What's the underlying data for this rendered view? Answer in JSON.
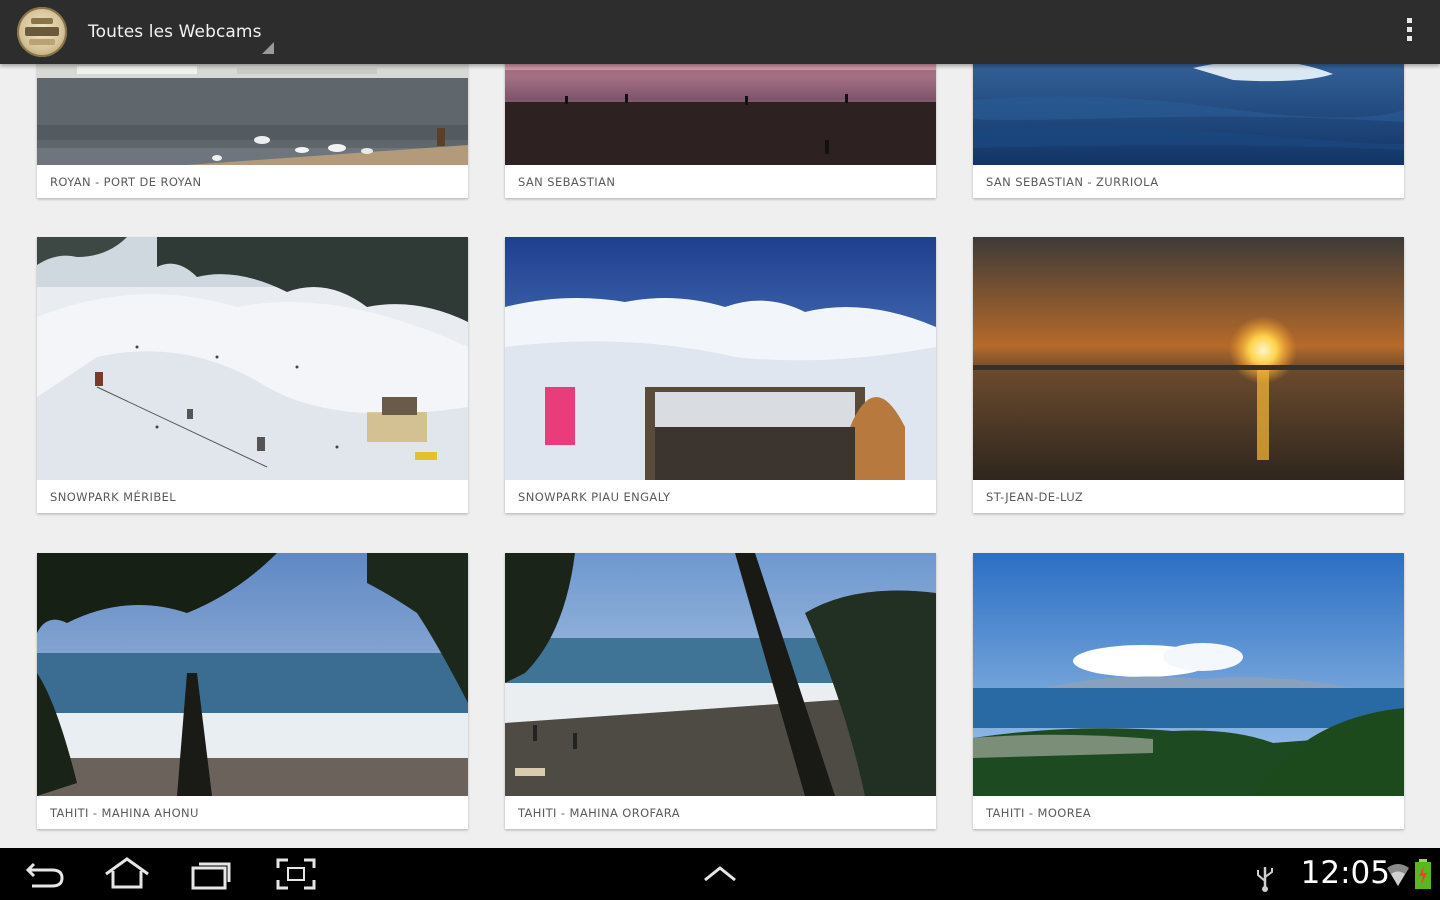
{
  "actionbar": {
    "title": "Toutes les Webcams"
  },
  "webcams": [
    {
      "name": "ROYAN - PORT DE ROYAN"
    },
    {
      "name": "SAN SEBASTIAN"
    },
    {
      "name": "SAN SEBASTIAN - ZURRIOLA"
    },
    {
      "name": "SNOWPARK MÉRIBEL"
    },
    {
      "name": "SNOWPARK PIAU ENGALY"
    },
    {
      "name": "ST-JEAN-DE-LUZ"
    },
    {
      "name": "TAHITI - MAHINA AHONU"
    },
    {
      "name": "TAHITI - MAHINA OROFARA"
    },
    {
      "name": "TAHITI - MOOREA"
    }
  ],
  "statusbar": {
    "time": "12:05"
  },
  "colors": {
    "actionbar": "#2d2d2d",
    "background": "#efefef",
    "card": "#ffffff",
    "caption": "#5a5a5a"
  }
}
